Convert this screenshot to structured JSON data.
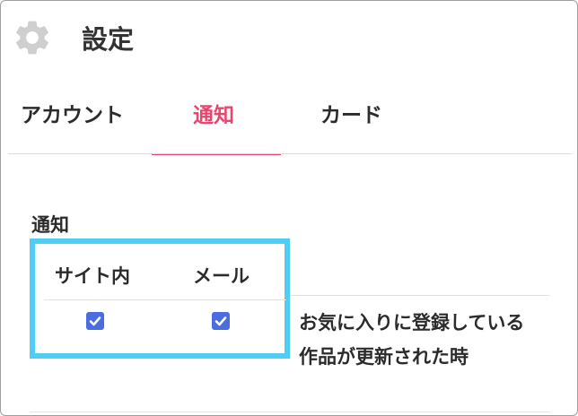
{
  "header": {
    "title": "設定",
    "icon": "gear-icon"
  },
  "tabs": [
    {
      "label": "アカウント",
      "active": false
    },
    {
      "label": "通知",
      "active": true
    },
    {
      "label": "カード",
      "active": false
    }
  ],
  "notification": {
    "section_label": "通知",
    "columns": [
      "サイト内",
      "メール"
    ],
    "rows": [
      {
        "site": true,
        "mail": true,
        "description": "お気に入りに登録している作品が更新された時"
      }
    ]
  },
  "colors": {
    "accent": "#e8456e",
    "checkbox": "#4a6ee0",
    "highlight": "#4fcdf5"
  }
}
